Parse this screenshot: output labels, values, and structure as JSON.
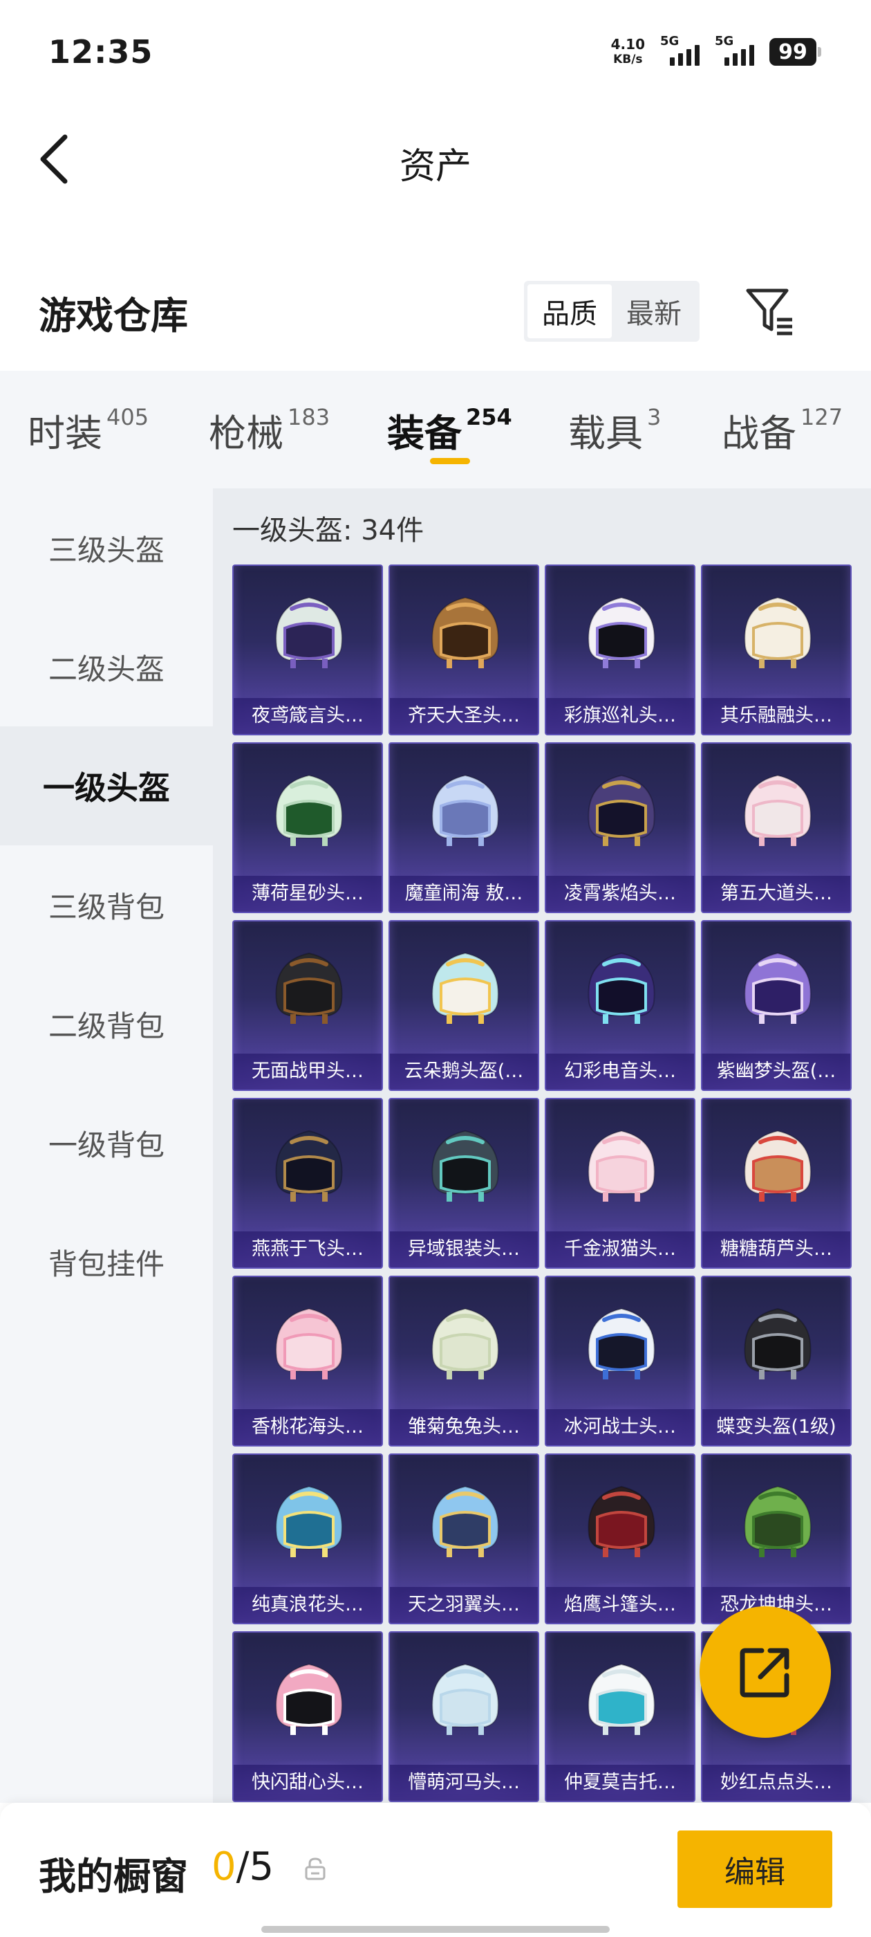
{
  "status_bar": {
    "time": "12:35",
    "net_speed_value": "4.10",
    "net_speed_unit": "KB/s",
    "signal_1_label": "5G",
    "signal_2_label": "5G",
    "battery": "99"
  },
  "nav": {
    "title": "资产"
  },
  "header": {
    "title": "游戏仓库",
    "sort_quality": "品质",
    "sort_latest": "最新"
  },
  "tabs": [
    {
      "label": "时装",
      "count": "405"
    },
    {
      "label": "枪械",
      "count": "183"
    },
    {
      "label": "装备",
      "count": "254"
    },
    {
      "label": "载具",
      "count": "3"
    },
    {
      "label": "战备",
      "count": "127"
    }
  ],
  "sidebar": [
    {
      "label": "三级头盔"
    },
    {
      "label": "二级头盔"
    },
    {
      "label": "一级头盔"
    },
    {
      "label": "三级背包"
    },
    {
      "label": "二级背包"
    },
    {
      "label": "一级背包"
    },
    {
      "label": "背包挂件"
    }
  ],
  "section_title": "一级头盔: 34件",
  "items": [
    {
      "name": "夜鸢箴言头…",
      "shell": "#dfe9e4",
      "accent": "#7a5fc0",
      "visor": "#2c2456"
    },
    {
      "name": "齐天大圣头…",
      "shell": "#a8743a",
      "accent": "#e0a75a",
      "visor": "#3b2412"
    },
    {
      "name": "彩旗巡礼头…",
      "shell": "#f4f1f6",
      "accent": "#8f7bd8",
      "visor": "#111118"
    },
    {
      "name": "其乐融融头…",
      "shell": "#f5efe2",
      "accent": "#d7b267",
      "visor": "#f5efe2"
    },
    {
      "name": "薄荷星砂头…",
      "shell": "#d9efdc",
      "accent": "#b8d9bd",
      "visor": "#1f5a2b"
    },
    {
      "name": "魔童闹海 敖…",
      "shell": "#c8d8f5",
      "accent": "#9fb4ea",
      "visor": "#6a78b8"
    },
    {
      "name": "凌霄紫焰头…",
      "shell": "#4a3e7a",
      "accent": "#c9a24c",
      "visor": "#14122a"
    },
    {
      "name": "第五大道头…",
      "shell": "#f7dfe6",
      "accent": "#eeb7c8",
      "visor": "#f1e7e8"
    },
    {
      "name": "无面战甲头…",
      "shell": "#2a2a2e",
      "accent": "#8b5a2b",
      "visor": "#1a1a1c"
    },
    {
      "name": "云朵鹅头盔(…",
      "shell": "#bfe8ec",
      "accent": "#f1c550",
      "visor": "#f5f2ea"
    },
    {
      "name": "幻彩电音头…",
      "shell": "#3a2d7a",
      "accent": "#7fe0f0",
      "visor": "#120f2a"
    },
    {
      "name": "紫幽梦头盔(…",
      "shell": "#8f74d6",
      "accent": "#e7d6f5",
      "visor": "#2e1f66"
    },
    {
      "name": "燕燕于飞头…",
      "shell": "#232846",
      "accent": "#b28a4a",
      "visor": "#111222"
    },
    {
      "name": "异域银装头…",
      "shell": "#3c4a55",
      "accent": "#62c9c0",
      "visor": "#111418"
    },
    {
      "name": "千金淑猫头…",
      "shell": "#f9e3ea",
      "accent": "#f2b3c5",
      "visor": "#f6d3dd"
    },
    {
      "name": "糖糖葫芦头…",
      "shell": "#f2e7de",
      "accent": "#d9473d",
      "visor": "#c98f5a"
    },
    {
      "name": "香桃花海头…",
      "shell": "#f6c5d4",
      "accent": "#f09ab7",
      "visor": "#f8dbe3"
    },
    {
      "name": "雏菊兔兔头…",
      "shell": "#e6ecd8",
      "accent": "#c9d6b2",
      "visor": "#dfe6cf"
    },
    {
      "name": "冰河战士头…",
      "shell": "#eef2f8",
      "accent": "#3d6fd6",
      "visor": "#15172a"
    },
    {
      "name": "蝶变头盔(1级)",
      "shell": "#2b2b30",
      "accent": "#9aa0aa",
      "visor": "#141416"
    },
    {
      "name": "纯真浪花头…",
      "shell": "#7fc4e8",
      "accent": "#f4e27a",
      "visor": "#1f6f93"
    },
    {
      "name": "天之羽翼头…",
      "shell": "#8fc7ef",
      "accent": "#e9c96a",
      "visor": "#2f3d66"
    },
    {
      "name": "焰鹰斗篷头…",
      "shell": "#2a1e22",
      "accent": "#c2463e",
      "visor": "#7a1620"
    },
    {
      "name": "恐龙坤坤头…",
      "shell": "#6fb04c",
      "accent": "#3e7c2c",
      "visor": "#2b4a20"
    },
    {
      "name": "快闪甜心头…",
      "shell": "#f2a9c2",
      "accent": "#ffffff",
      "visor": "#141418"
    },
    {
      "name": "懵萌河马头…",
      "shell": "#d9ecf5",
      "accent": "#b9d7ea",
      "visor": "#cfe4ef"
    },
    {
      "name": "仲夏莫吉托…",
      "shell": "#f5f8f9",
      "accent": "#d9e6ea",
      "visor": "#2fb3c9"
    },
    {
      "name": "妙红点点头…",
      "shell": "#f4f0ee",
      "accent": "#d84e5a",
      "visor": "#eee8e6"
    }
  ],
  "showcase": {
    "label": "我的橱窗",
    "current": "0",
    "total": "/5"
  },
  "edit_label": "编辑",
  "colors": {
    "accent": "#f5b400",
    "card_top": "#23234a",
    "card_bottom": "#6e55c4"
  },
  "icons": {
    "back": "chevron-left-icon",
    "filter": "filter-funnel-icon",
    "share": "external-link-icon",
    "lock": "lock-icon"
  }
}
